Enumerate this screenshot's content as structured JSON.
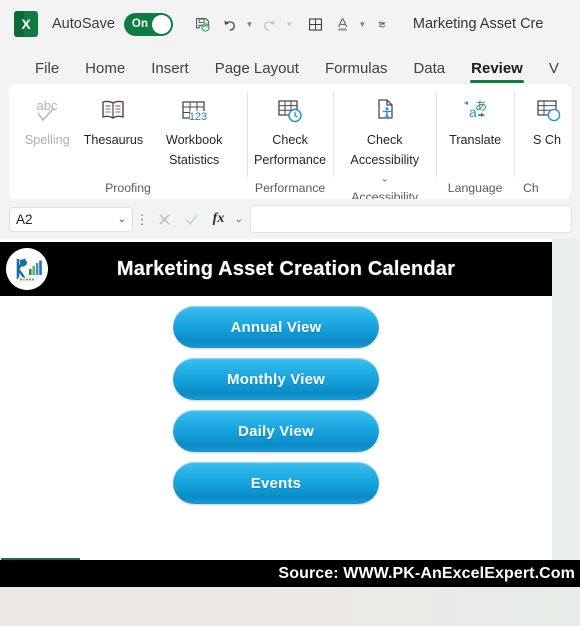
{
  "titlebar": {
    "app_icon": "excel-icon",
    "autosave_label": "AutoSave",
    "autosave_state": "On",
    "document_title": "Marketing Asset Cre",
    "qat": [
      {
        "name": "save-icon",
        "label": "Save"
      },
      {
        "name": "undo-icon",
        "label": "Undo"
      },
      {
        "name": "redo-icon",
        "label": "Redo"
      },
      {
        "name": "borders-icon",
        "label": "Borders"
      },
      {
        "name": "font-color-icon",
        "label": "Font Color"
      },
      {
        "name": "customize-quick-access-toolbar-icon",
        "label": "Customize Quick Access Toolbar"
      }
    ]
  },
  "ribbon": {
    "tabs": [
      {
        "label": "File",
        "active": false
      },
      {
        "label": "Home",
        "active": false
      },
      {
        "label": "Insert",
        "active": false
      },
      {
        "label": "Page Layout",
        "active": false
      },
      {
        "label": "Formulas",
        "active": false
      },
      {
        "label": "Data",
        "active": false
      },
      {
        "label": "Review",
        "active": true
      },
      {
        "label": "V",
        "active": false
      }
    ],
    "groups": [
      {
        "name": "Proofing",
        "items": [
          {
            "label": "Spelling",
            "icon": "abc-check-icon",
            "disabled": true,
            "dropdown": false
          },
          {
            "label": "Thesaurus",
            "icon": "book-icon",
            "disabled": false,
            "dropdown": false
          },
          {
            "label": "Workbook Statistics",
            "icon": "table-123-icon",
            "disabled": false,
            "dropdown": false
          }
        ]
      },
      {
        "name": "Performance",
        "items": [
          {
            "label": "Check Performance",
            "icon": "table-clock-icon",
            "disabled": false,
            "dropdown": false
          }
        ]
      },
      {
        "name": "Accessibility",
        "items": [
          {
            "label": "Check Accessibility",
            "icon": "accessibility-page-icon",
            "disabled": false,
            "dropdown": true
          }
        ]
      },
      {
        "name": "Language",
        "items": [
          {
            "label": "Translate",
            "icon": "translate-icon",
            "disabled": false,
            "dropdown": false
          }
        ]
      },
      {
        "name": "Ch",
        "items": [
          {
            "label": "S Ch",
            "icon": "show-changes-icon",
            "disabled": false,
            "dropdown": false
          }
        ]
      }
    ]
  },
  "formula_bar": {
    "name_box_value": "A2",
    "name_box_chevron": "chevron-down-icon",
    "cancel_icon": "cancel-icon",
    "enter_icon": "enter-check-icon",
    "fx_label": "fx",
    "fx_chevron": "chevron-down-icon",
    "formula_value": "",
    "formula_placeholder": ""
  },
  "sheet": {
    "selected_cell": "A2",
    "banner": {
      "logo": "pk-an-excel-expert-logo",
      "title": "Marketing Asset Creation Calendar",
      "background_color": "#000000",
      "text_color": "#ffffff"
    },
    "buttons": [
      {
        "label": "Annual View",
        "name": "annual-view-button"
      },
      {
        "label": "Monthly View",
        "name": "monthly-view-button"
      },
      {
        "label": "Daily View",
        "name": "daily-view-button"
      },
      {
        "label": "Events",
        "name": "events-button"
      }
    ],
    "button_color_top": "#3ec0ef",
    "button_color_bottom": "#0b8bc6",
    "footer": {
      "text": "Source: WWW.PK-AnExcelExpert.Com",
      "background_color": "#000000",
      "text_color": "#ffffff"
    }
  },
  "theme": {
    "accent_green": "#107c41",
    "selection_green": "#1d6b4a",
    "ribbon_bg": "#ffffff",
    "chrome_bg": "#f3f3f3"
  }
}
